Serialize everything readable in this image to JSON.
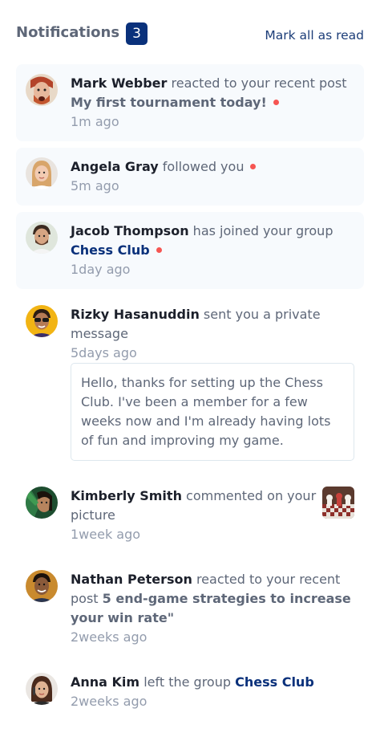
{
  "header": {
    "title": "Notifications",
    "unread_count": "3",
    "mark_all_label": "Mark all as read"
  },
  "colors": {
    "accent": "#0a317b",
    "unread_bg": "#f7fafd",
    "dot": "#f65552",
    "name": "#1c202b",
    "text": "#5e6778",
    "muted": "#939cad"
  },
  "notifications": [
    {
      "name": "Mark Webber",
      "action": "reacted to your recent post",
      "target": "My first tournament today!",
      "time": "1m ago",
      "unread": true,
      "avatar": "avatar-mark-webber"
    },
    {
      "name": "Angela Gray",
      "action": "followed you",
      "time": "5m ago",
      "unread": true,
      "avatar": "avatar-angela-gray"
    },
    {
      "name": "Jacob Thompson",
      "action": "has joined your group",
      "target": "Chess Club",
      "time": "1day ago",
      "unread": true,
      "avatar": "avatar-jacob-thompson"
    },
    {
      "name": "Rizky Hasanuddin",
      "action": "sent you a private message",
      "time": "5days ago",
      "unread": false,
      "message": "Hello, thanks for setting up the Chess Club. I've been a member for a few weeks now and I'm already having lots of fun and improving my game.",
      "avatar": "avatar-rizky-hasanuddin"
    },
    {
      "name": "Kimberly Smith",
      "action": "commented on your picture",
      "time": "1week ago",
      "unread": false,
      "avatar": "avatar-kimberly-smith",
      "thumbnail": "chess-picture-thumbnail"
    },
    {
      "name": "Nathan Peterson",
      "action": "reacted to your recent post",
      "target": "5 end-game strategies to increase your win rate\"",
      "time": "2weeks ago",
      "unread": false,
      "avatar": "avatar-nathan-peterson"
    },
    {
      "name": "Anna Kim",
      "action": "left the group",
      "target": "Chess Club",
      "time": "2weeks ago",
      "unread": false,
      "avatar": "avatar-anna-kim"
    }
  ]
}
